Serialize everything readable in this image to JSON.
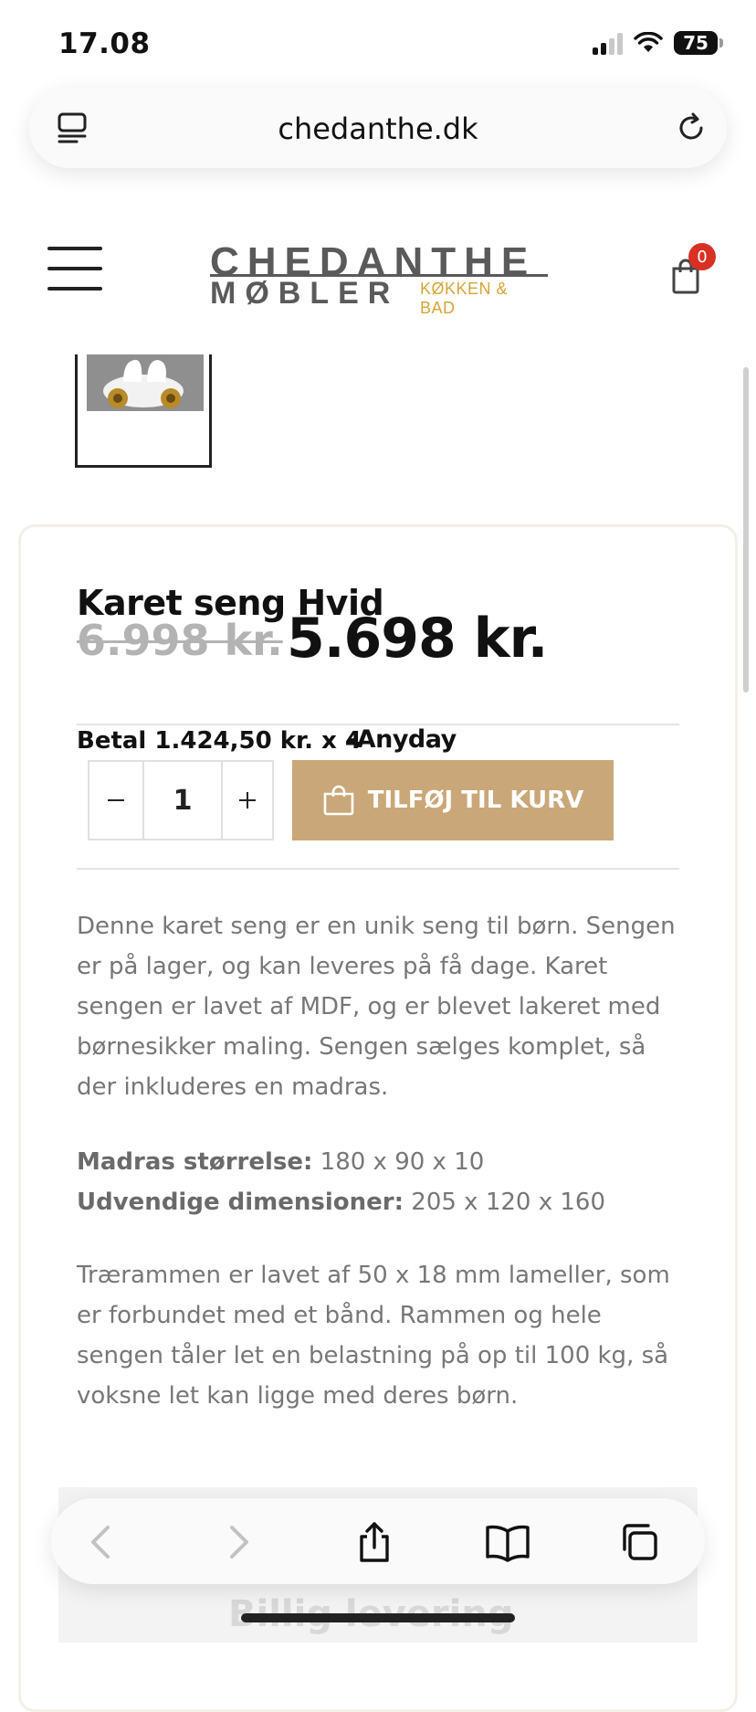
{
  "status_bar": {
    "time": "17.08",
    "battery": "75"
  },
  "browser": {
    "url": "chedanthe.dk"
  },
  "header": {
    "logo": {
      "line1": "CHEDANTHE",
      "line2": "MØBLER",
      "tagline": "KØKKEN & BAD"
    },
    "cart_count": "0",
    "menu_icon": "hamburger-icon",
    "cart_icon": "shopping-bag-icon"
  },
  "product": {
    "title": "Karet seng Hvid",
    "old_price": "6.998 kr.",
    "new_price": "5.698 kr.",
    "installment": "Betal 1.424,50 kr. x 4",
    "installment_provider": "-Anyday",
    "quantity": "1",
    "add_to_cart_label": "TILFØJ TIL KURV",
    "description": "Denne karet seng er en unik seng til børn. Sengen er på lager, og kan leveres på få dage. Karet sengen er lavet af MDF, og er blevet lakeret med børnesikker maling. Sengen sælges komplet, så der inkluderes en madras.",
    "specs": [
      {
        "label": "Madras størrelse:",
        "value": " 180 x 90 x 10"
      },
      {
        "label": "Udvendige dimensioner:",
        "value": " 205 x 120 x 160"
      }
    ],
    "frame_text": "Trærammen er lavet af 50 x 18 mm lameller, som er forbundet med et bånd. Rammen og hele sengen tåler let en belastning på op til 100 kg, så voksne let kan ligge med deres børn."
  },
  "promo": {
    "text": "Billig levering"
  },
  "colors": {
    "accent": "#c9a778",
    "badge": "#d93025",
    "logo_gold": "#d4a53a"
  }
}
